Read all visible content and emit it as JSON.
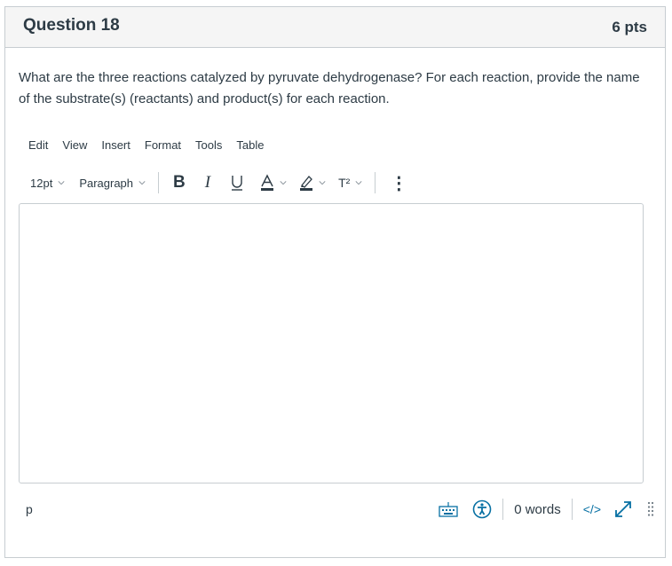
{
  "question": {
    "title": "Question 18",
    "points": "6 pts",
    "text": "What are the three reactions catalyzed by pyruvate dehydrogenase?  For each reaction, provide the name of the substrate(s) (reactants) and product(s) for each reaction."
  },
  "editor": {
    "menu": [
      "Edit",
      "View",
      "Insert",
      "Format",
      "Tools",
      "Table"
    ],
    "toolbar": {
      "font_size": "12pt",
      "block_format": "Paragraph",
      "bold_icon": "B",
      "italic_icon": "I",
      "underline_icon": "U",
      "text_color_icon": "A",
      "superscript_icon": "T²",
      "more_icon": "⋮"
    },
    "content": "",
    "status": {
      "path": "p",
      "word_count": "0 words",
      "html_toggle": "</>"
    }
  },
  "colors": {
    "accent": "#0770a3",
    "text": "#2d3b45",
    "border": "#c7cdd1",
    "header_bg": "#f5f5f5"
  }
}
